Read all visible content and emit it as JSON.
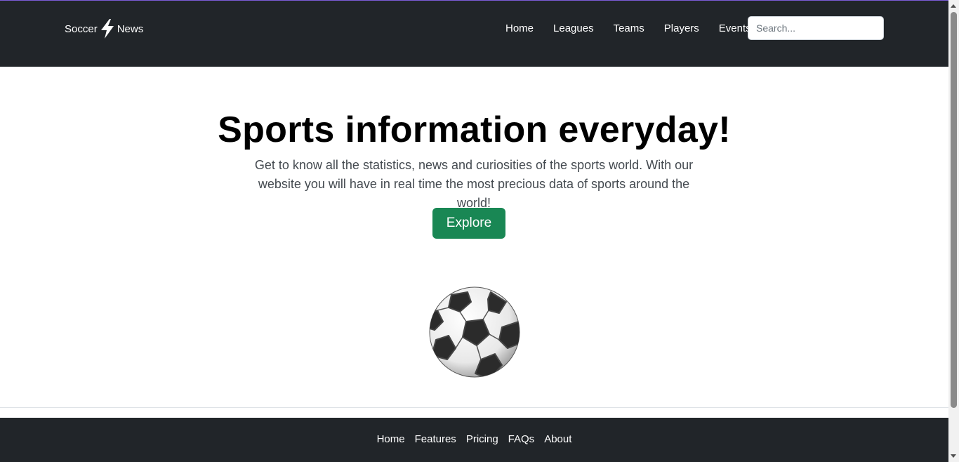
{
  "navbar": {
    "brand_left": "Soccer",
    "brand_icon": "lightning-bolt-icon",
    "brand_right": "News",
    "links": [
      {
        "label": "Home"
      },
      {
        "label": "Leagues"
      },
      {
        "label": "Teams"
      },
      {
        "label": "Players"
      },
      {
        "label": "Events"
      }
    ],
    "search": {
      "placeholder": "Search...",
      "value": ""
    }
  },
  "hero": {
    "title": "Sports information everyday!",
    "description": "Get to know all the statistics, news and curiosities of the sports world. With our website you will have in real time the most precious data of sports around the world!",
    "button_label": "Explore",
    "image_icon": "soccer-ball-icon"
  },
  "footer": {
    "links": [
      {
        "label": "Home"
      },
      {
        "label": "Features"
      },
      {
        "label": "Pricing"
      },
      {
        "label": "FAQs"
      },
      {
        "label": "About"
      }
    ]
  },
  "colors": {
    "navbar_bg": "#212529",
    "accent_green": "#198754",
    "text_light": "#ffffff"
  }
}
